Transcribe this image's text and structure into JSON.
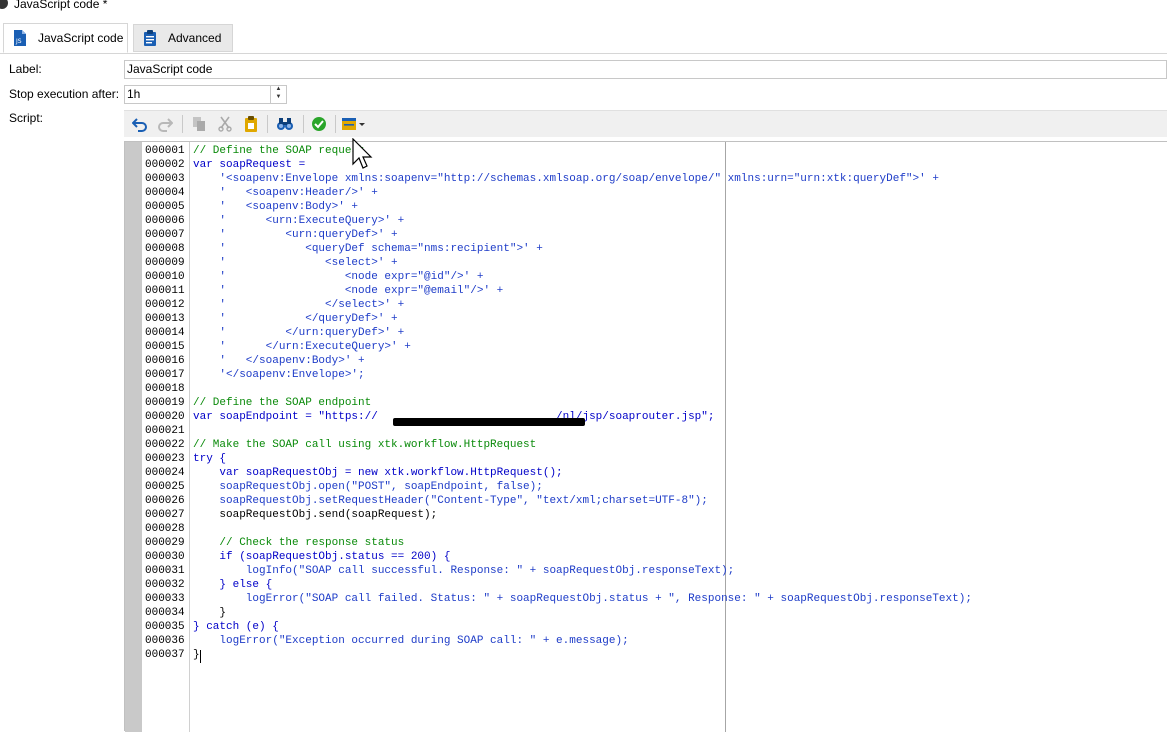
{
  "window": {
    "title": "JavaScript code *"
  },
  "tabs": [
    {
      "label": "JavaScript code",
      "active": true,
      "icon": "js-file-icon"
    },
    {
      "label": "Advanced",
      "active": false,
      "icon": "clipboard-icon"
    }
  ],
  "form": {
    "label_caption": "Label:",
    "label_value": "JavaScript code",
    "stop_caption": "Stop execution after:",
    "stop_value": "1h",
    "script_caption": "Script:"
  },
  "toolbar": {
    "icons": [
      "undo-icon",
      "redo-icon",
      "copy-icon",
      "cut-icon",
      "paste-icon",
      "find-icon",
      "check-syntax-icon",
      "insert-menu-icon"
    ]
  },
  "colors": {
    "comment": "#0a8a0a",
    "keyword": "#0000c8",
    "string": "#1e3cc8",
    "accent": "#1a5fb4"
  },
  "code": {
    "line_numbers": [
      "000001",
      "000002",
      "000003",
      "000004",
      "000005",
      "000006",
      "000007",
      "000008",
      "000009",
      "000010",
      "000011",
      "000012",
      "000013",
      "000014",
      "000015",
      "000016",
      "000017",
      "000018",
      "000019",
      "000020",
      "000021",
      "000022",
      "000023",
      "000024",
      "000025",
      "000026",
      "000027",
      "000028",
      "000029",
      "000030",
      "000031",
      "000032",
      "000033",
      "000034",
      "000035",
      "000036",
      "000037"
    ],
    "lines": [
      "// Define the SOAP request",
      "var soapRequest =",
      "    '<soapenv:Envelope xmlns:soapenv=\"http://schemas.xmlsoap.org/soap/envelope/\" xmlns:urn=\"urn:xtk:queryDef\">' +",
      "    '   <soapenv:Header/>' +",
      "    '   <soapenv:Body>' +",
      "    '      <urn:ExecuteQuery>' +",
      "    '         <urn:queryDef>' +",
      "    '            <queryDef schema=\"nms:recipient\">' +",
      "    '               <select>' +",
      "    '                  <node expr=\"@id\"/>' +",
      "    '                  <node expr=\"@email\"/>' +",
      "    '               </select>' +",
      "    '            </queryDef>' +",
      "    '         </urn:queryDef>' +",
      "    '      </urn:ExecuteQuery>' +",
      "    '   </soapenv:Body>' +",
      "    '</soapenv:Envelope>';",
      "",
      "// Define the SOAP endpoint",
      "var soapEndpoint = \"https://                           /nl/jsp/soaprouter.jsp\";",
      "",
      "// Make the SOAP call using xtk.workflow.HttpRequest",
      "try {",
      "    var soapRequestObj = new xtk.workflow.HttpRequest();",
      "    soapRequestObj.open(\"POST\", soapEndpoint, false);",
      "    soapRequestObj.setRequestHeader(\"Content-Type\", \"text/xml;charset=UTF-8\");",
      "    soapRequestObj.send(soapRequest);",
      "",
      "    // Check the response status",
      "    if (soapRequestObj.status == 200) {",
      "        logInfo(\"SOAP call successful. Response: \" + soapRequestObj.responseText);",
      "    } else {",
      "        logError(\"SOAP call failed. Status: \" + soapRequestObj.status + \", Response: \" + soapRequestObj.responseText);",
      "    }",
      "} catch (e) {",
      "    logError(\"Exception occurred during SOAP call: \" + e.message);",
      "}"
    ],
    "kinds": [
      "cm",
      "kw",
      "st",
      "st",
      "st",
      "st",
      "st",
      "st",
      "st",
      "st",
      "st",
      "st",
      "st",
      "st",
      "st",
      "st",
      "st",
      "",
      "cm",
      "kw",
      "",
      "cm",
      "kw",
      "kw",
      "st",
      "st",
      "",
      "",
      "cm",
      "kw",
      "st",
      "kw",
      "st",
      "",
      "kw",
      "st",
      ""
    ]
  }
}
